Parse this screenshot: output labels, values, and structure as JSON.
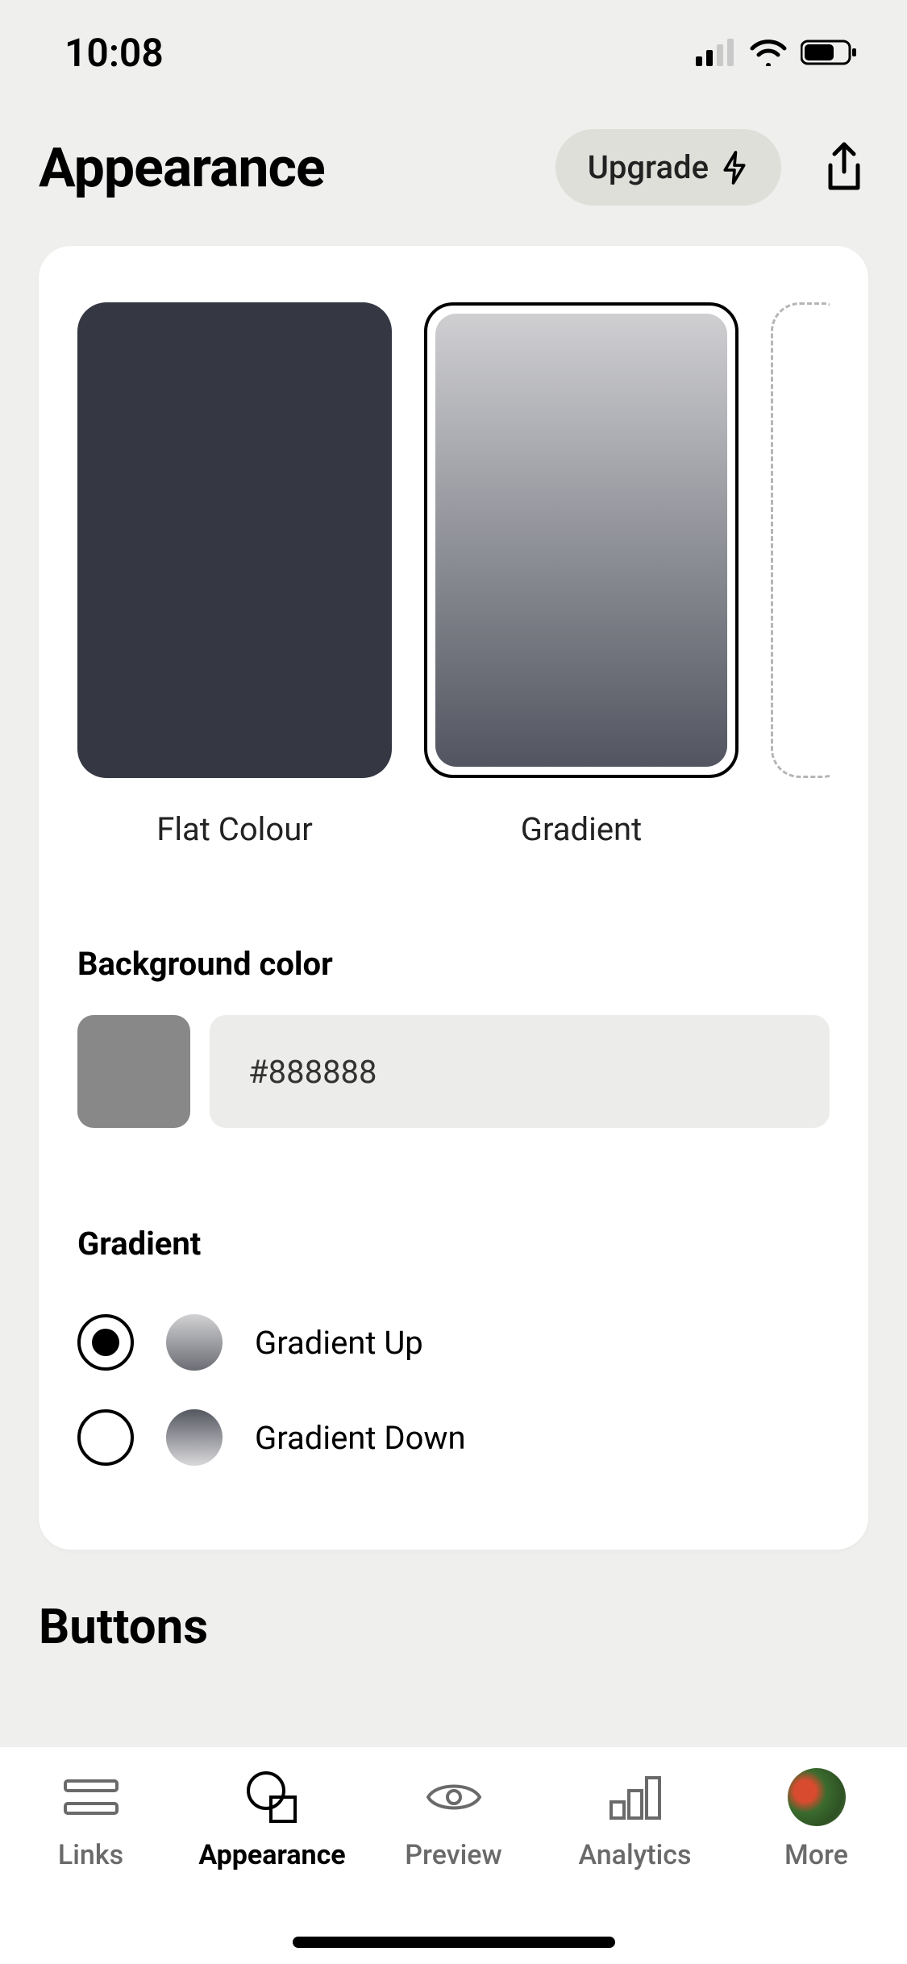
{
  "status": {
    "time": "10:08"
  },
  "header": {
    "title": "Appearance",
    "upgrade_label": "Upgrade"
  },
  "styles": {
    "options": [
      {
        "label": "Flat Colour"
      },
      {
        "label": "Gradient"
      }
    ]
  },
  "background": {
    "heading": "Background color",
    "hex": "#888888",
    "swatch_color": "#888888"
  },
  "gradient": {
    "heading": "Gradient",
    "options": [
      {
        "label": "Gradient Up",
        "selected": true
      },
      {
        "label": "Gradient Down",
        "selected": false
      }
    ]
  },
  "buttons_heading": "Buttons",
  "tabs": {
    "items": [
      {
        "label": "Links"
      },
      {
        "label": "Appearance"
      },
      {
        "label": "Preview"
      },
      {
        "label": "Analytics"
      },
      {
        "label": "More"
      }
    ]
  }
}
